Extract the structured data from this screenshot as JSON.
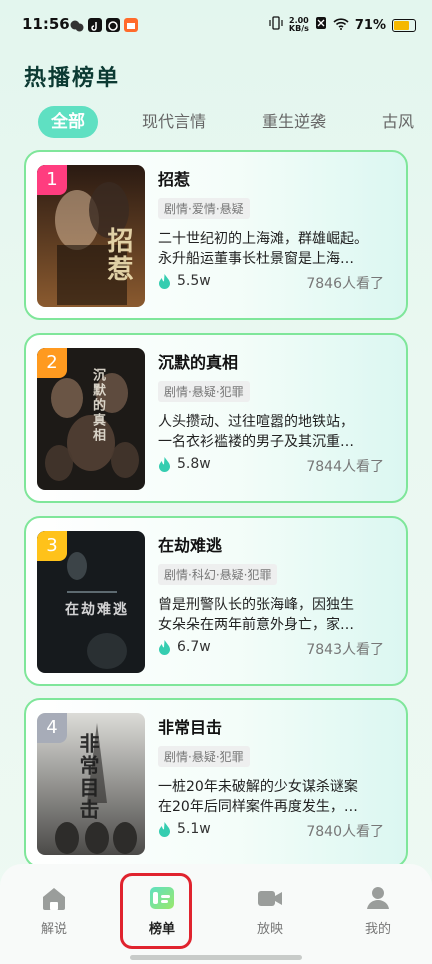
{
  "status_bar": {
    "time": "11:56",
    "net_speed_value": "2.00",
    "net_speed_unit": "KB/s",
    "battery": "71%"
  },
  "page_title": "热播榜单",
  "tabs": [
    {
      "label": "全部",
      "active": true
    },
    {
      "label": "现代言情"
    },
    {
      "label": "重生逆袭"
    },
    {
      "label": "古风"
    }
  ],
  "items": [
    {
      "rank": "1",
      "title": "招惹",
      "tags": "剧情·爱情·悬疑",
      "desc_line1": "二十世纪初的上海滩，群雄崛起。",
      "desc_line2": "永升船运董事长杜景窗是上海…",
      "hot": "5.5w",
      "views": "7846人看了",
      "poster_text": "招惹",
      "rank_color": "#ff3d7f"
    },
    {
      "rank": "2",
      "title": "沉默的真相",
      "tags": "剧情·悬疑·犯罪",
      "desc_line1": "人头攒动、过往喧嚣的地铁站，",
      "desc_line2": "一名衣衫褴褛的男子及其沉重…",
      "hot": "5.8w",
      "views": "7844人看了",
      "poster_text": "沉默的真相",
      "rank_color": "#ff9a1f"
    },
    {
      "rank": "3",
      "title": "在劫难逃",
      "tags": "剧情·科幻·悬疑·犯罪",
      "desc_line1": "曾是刑警队长的张海峰，因独生",
      "desc_line2": "女朵朵在两年前意外身亡，家…",
      "hot": "6.7w",
      "views": "7843人看了",
      "poster_text": "在劫难逃",
      "rank_color": "#ffc21a"
    },
    {
      "rank": "4",
      "title": "非常目击",
      "tags": "剧情·悬疑·犯罪",
      "desc_line1": "一桩20年未破解的少女谋杀谜案",
      "desc_line2": "在20年后同样案件再度发生，…",
      "hot": "5.1w",
      "views": "7840人看了",
      "poster_text": "非常目击",
      "rank_color": "#a7acb8"
    }
  ],
  "tabbar": [
    {
      "label": "解说",
      "icon": "home-icon"
    },
    {
      "label": "榜单",
      "icon": "ranking-icon",
      "active": true
    },
    {
      "label": "放映",
      "icon": "video-camera-icon"
    },
    {
      "label": "我的",
      "icon": "profile-icon"
    }
  ],
  "colors": {
    "accent": "#5fe0c2",
    "card_border": "#7fe69a",
    "highlight": "#e0232e"
  }
}
